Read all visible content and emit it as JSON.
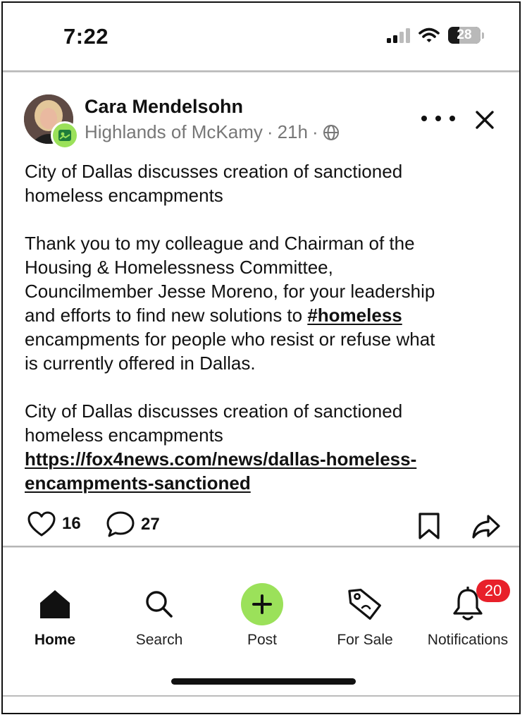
{
  "status": {
    "time": "7:22",
    "battery": "28"
  },
  "post": {
    "author": "Cara Mendelsohn",
    "neighborhood": "Highlands of McKamy",
    "sep1": "·",
    "age": "21h",
    "sep2": "·",
    "title_line1": "City of Dallas discusses creation of sanctioned",
    "title_line2": "homeless encampments",
    "para_line1": "Thank you to my colleague and Chairman of the",
    "para_line2": "Housing & Homelessness Committee,",
    "para_line3": "Councilmember Jesse Moreno, for your leadership",
    "para_line4_a": "and efforts to find new solutions to ",
    "hashtag": "#homeless",
    "para_line5": "encampments for people who resist or refuse what",
    "para_line6": "is currently offered in Dallas.",
    "link_title_line1": "City of Dallas discusses creation of sanctioned",
    "link_title_line2": "homeless encampments",
    "url_line1": "https://fox4news.com/news/dallas-homeless-",
    "url_line2": "encampments-sanctioned",
    "likes": "16",
    "comments": "27"
  },
  "nav": {
    "home": "Home",
    "search": "Search",
    "post": "Post",
    "for_sale": "For Sale",
    "notifications": "Notifications",
    "notifications_count": "20"
  },
  "colors": {
    "accent_green": "#9be15a",
    "badge_red": "#e8202a"
  }
}
